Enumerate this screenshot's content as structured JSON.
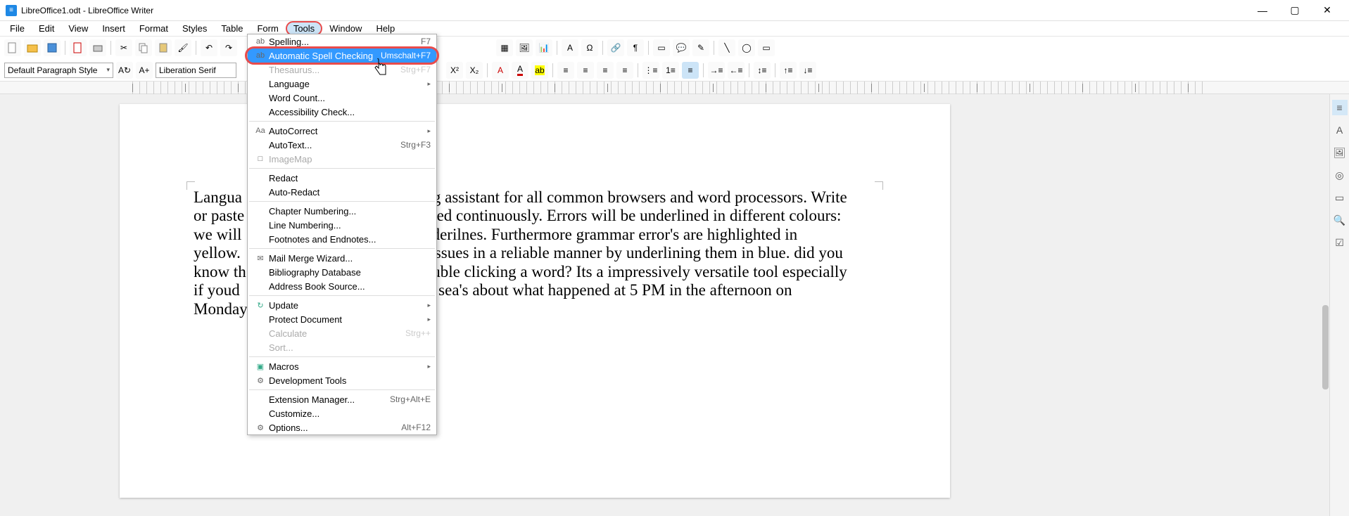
{
  "window": {
    "title": "LibreOffice1.odt - LibreOffice Writer"
  },
  "menubar": {
    "items": [
      {
        "label": "File",
        "u": "F"
      },
      {
        "label": "Edit",
        "u": "E"
      },
      {
        "label": "View",
        "u": "V"
      },
      {
        "label": "Insert",
        "u": "I"
      },
      {
        "label": "Format",
        "u": "o"
      },
      {
        "label": "Styles",
        "u": "S"
      },
      {
        "label": "Table",
        "u": "a"
      },
      {
        "label": "Form",
        "u": "m"
      },
      {
        "label": "Tools",
        "u": "T",
        "active": true
      },
      {
        "label": "Window",
        "u": "W"
      },
      {
        "label": "Help",
        "u": "H"
      }
    ]
  },
  "toolbar": {
    "paragraph_style": "Default Paragraph Style",
    "font_name": "Liberation Serif"
  },
  "tools_menu": [
    {
      "label": "Spelling...",
      "accel": "F7",
      "icon": "abc"
    },
    {
      "label": "Automatic Spell Checking",
      "accel": "Umschalt+F7",
      "highlight": true,
      "icon": "ab✓"
    },
    {
      "label": "Thesaurus...",
      "accel": "Strg+F7",
      "disabled": true
    },
    {
      "label": "Language",
      "submenu": true
    },
    {
      "label": "Word Count..."
    },
    {
      "label": "Accessibility Check..."
    },
    {
      "sep": true
    },
    {
      "label": "AutoCorrect",
      "submenu": true,
      "icon": "Aa"
    },
    {
      "label": "AutoText...",
      "accel": "Strg+F3"
    },
    {
      "label": "ImageMap",
      "disabled": true,
      "icon": "□"
    },
    {
      "sep": true
    },
    {
      "label": "Redact"
    },
    {
      "label": "Auto-Redact"
    },
    {
      "sep": true
    },
    {
      "label": "Chapter Numbering..."
    },
    {
      "label": "Line Numbering..."
    },
    {
      "label": "Footnotes and Endnotes..."
    },
    {
      "sep": true
    },
    {
      "label": "Mail Merge Wizard...",
      "icon": "✉"
    },
    {
      "label": "Bibliography Database"
    },
    {
      "label": "Address Book Source..."
    },
    {
      "sep": true
    },
    {
      "label": "Update",
      "submenu": true,
      "icon": "↻"
    },
    {
      "label": "Protect Document",
      "submenu": true
    },
    {
      "label": "Calculate",
      "accel": "Strg++",
      "disabled": true
    },
    {
      "label": "Sort...",
      "disabled": true
    },
    {
      "sep": true
    },
    {
      "label": "Macros",
      "submenu": true,
      "icon": "▣"
    },
    {
      "label": "Development Tools",
      "icon": "⚙"
    },
    {
      "sep": true
    },
    {
      "label": "Extension Manager...",
      "accel": "Strg+Alt+E"
    },
    {
      "label": "Customize..."
    },
    {
      "label": "Options...",
      "accel": "Alt+F12",
      "icon": "⚙"
    }
  ],
  "document": {
    "lines": [
      "Langua                                            ing assistant for all common browsers and word processors. Write",
      "or paste                                          ecked continuously. Errors will be underlined in different colours:",
      "we will                                           underilnes. Furthermore grammar error's are highlighted in",
      "yellow.                                           le issues in a reliable manner by underlining them in blue. did you",
      "know th                                          double clicking a word? Its a impressively versatile tool especially",
      "if youd                                           ver sea's about what happened at 5 PM in the afternoon on",
      "Monday"
    ]
  }
}
